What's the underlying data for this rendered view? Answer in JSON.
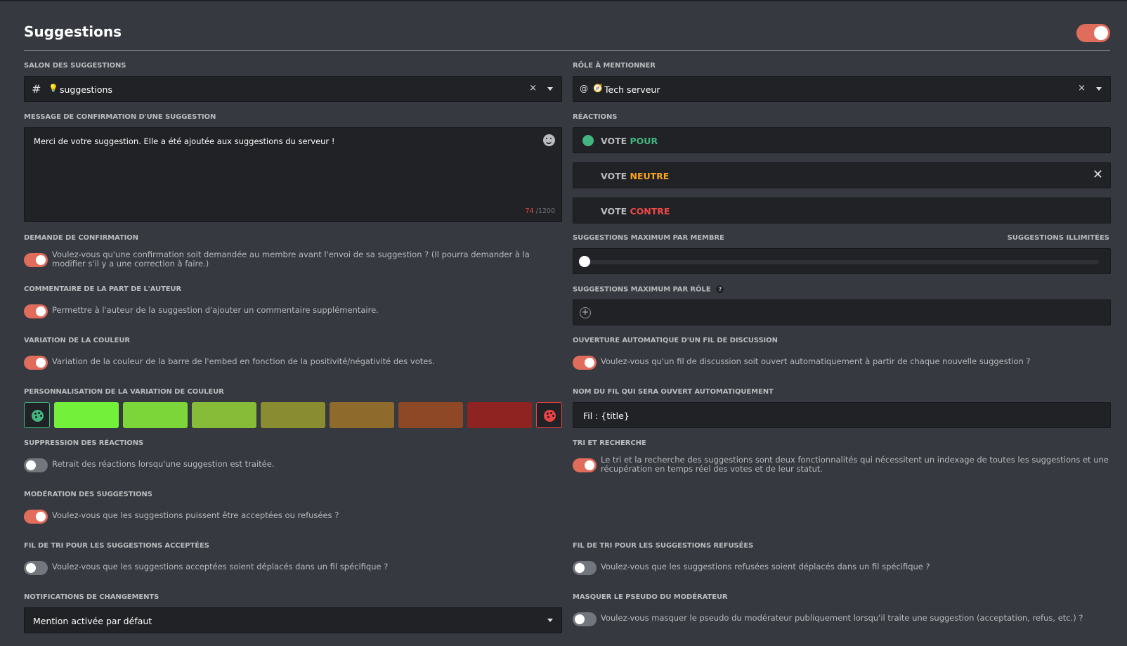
{
  "header": {
    "title": "Suggestions",
    "enabled": true
  },
  "left": {
    "salon": {
      "label": "SALON DES SUGGESTIONS",
      "hash": "#",
      "emoji": "💡",
      "value": "suggestions",
      "clear": "×"
    },
    "message": {
      "label": "MESSAGE DE CONFIRMATION D'UNE SUGGESTION",
      "value": "Merci de votre suggestion. Elle a été ajoutée aux suggestions du serveur !",
      "count": "74",
      "max": " /1200"
    },
    "confirmation": {
      "label": "DEMANDE DE CONFIRMATION",
      "desc": "Voulez-vous qu'une confirmation soit demandée au membre avant l'envoi de sa suggestion ? (Il pourra demander à la modifier s'il y a une correction à faire.)",
      "on": true
    },
    "commentaire": {
      "label": "COMMENTAIRE DE LA PART DE L'AUTEUR",
      "desc": "Permettre à l'auteur de la suggestion d'ajouter un commentaire supplémentaire.",
      "on": true
    },
    "variation": {
      "label": "VARIATION DE LA COULEUR",
      "desc": "Variation de la couleur de la barre de l'embed en fonction de la positivité/négativité des votes.",
      "on": true
    },
    "perso": {
      "label": "PERSONNALISATION DE LA VARIATION DE COULEUR",
      "start_color": "#43b581",
      "end_color": "#ed4245",
      "colors": [
        "#72f03a",
        "#7cd63a",
        "#87bc38",
        "#8a8c32",
        "#8e6a2c",
        "#8e4826",
        "#8f2322"
      ]
    },
    "suppression": {
      "label": "SUPPRESSION DES RÉACTIONS",
      "desc": "Retrait des réactions lorsqu'une suggestion est traitée.",
      "on": false
    },
    "moderation": {
      "label": "MODÉRATION DES SUGGESTIONS",
      "desc": "Voulez-vous que les suggestions puissent être acceptées ou refusées ?",
      "on": true
    },
    "tri_acceptees": {
      "label": "FIL DE TRI POUR LES SUGGESTIONS ACCEPTÉES",
      "desc": "Voulez-vous que les suggestions acceptées soient déplacés dans un fil spécifique ?",
      "on": false
    },
    "notifications": {
      "label": "NOTIFICATIONS DE CHANGEMENTS",
      "value": "Mention activée par défaut"
    }
  },
  "right": {
    "role": {
      "label": "RÔLE À MENTIONNER",
      "at": "@",
      "emoji": "🧭",
      "value": "Tech serveur",
      "clear": "×"
    },
    "reactions": {
      "label": "RÉACTIONS",
      "items": [
        {
          "prefix": "VOTE ",
          "word": "POUR",
          "color": "#43b581",
          "dot": true,
          "removable": false
        },
        {
          "prefix": "VOTE ",
          "word": "NEUTRE",
          "color": "#faa61a",
          "dot": false,
          "removable": true
        },
        {
          "prefix": "VOTE ",
          "word": "CONTRE",
          "color": "#f04747",
          "dot": false,
          "removable": false
        }
      ],
      "remove": "✕"
    },
    "max_membre": {
      "label": "SUGGESTIONS MAXIMUM PAR MEMBRE",
      "value_label": "SUGGESTIONS ILLIMITÉES",
      "value": 0
    },
    "max_role": {
      "label": "SUGGESTIONS MAXIMUM PAR RÔLE",
      "help": "?",
      "add": "+"
    },
    "ouverture": {
      "label": "OUVERTURE AUTOMATIQUE D'UN FIL DE DISCUSSION",
      "desc": "Voulez-vous qu'un fil de discussion soit ouvert automatiquement à partir de chaque nouvelle suggestion ?",
      "on": true
    },
    "nom_fil": {
      "label": "NOM DU FIL QUI SERA OUVERT AUTOMATIQUEMENT",
      "value": "Fil : {title}"
    },
    "tri_recherche": {
      "label": "TRI ET RECHERCHE",
      "desc": "Le tri et la recherche des suggestions sont deux fonctionnalités qui nécessitent un indexage de toutes les suggestions et une récupération en temps réel des votes et de leur statut.",
      "on": true
    },
    "tri_refusees": {
      "label": "FIL DE TRI POUR LES SUGGESTIONS REFUSÉES",
      "desc": "Voulez-vous que les suggestions refusées soient déplacés dans un fil spécifique ?",
      "on": false
    },
    "masquer": {
      "label": "MASQUER LE PSEUDO DU MODÉRATEUR",
      "desc": "Voulez-vous masquer le pseudo du modérateur publiquement lorsqu'il traite une suggestion (acceptation, refus, etc.) ?",
      "on": false
    }
  }
}
